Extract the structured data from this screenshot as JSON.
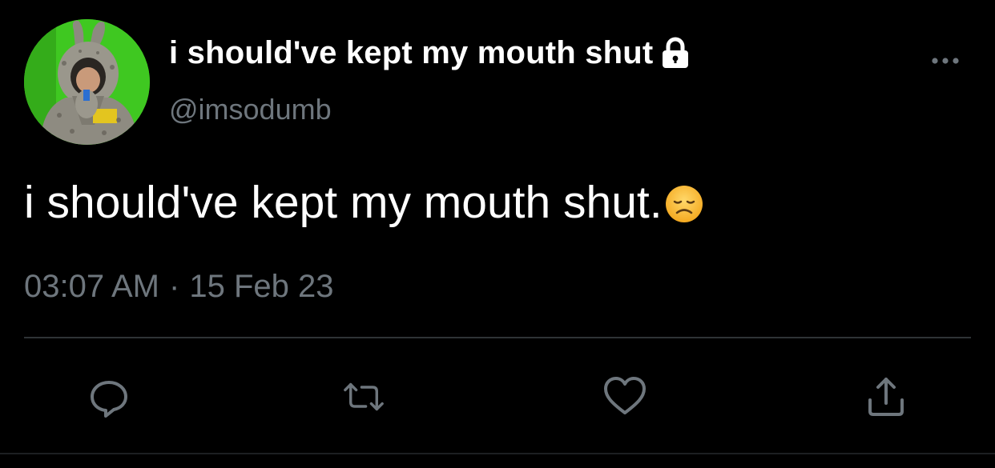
{
  "tweet": {
    "display_name": "i should've kept my mouth shut",
    "handle": "@imsodumb",
    "text": "i should've kept my mouth shut.",
    "time": "03:07 AM",
    "separator": "·",
    "date": "15 Feb 23"
  },
  "icons": {
    "lock": "lock-icon",
    "more": "more-horizontal-icon",
    "emoji": "disappointed-face-emoji",
    "reply": "reply-icon",
    "retweet": "retweet-icon",
    "like": "heart-icon",
    "share": "share-icon"
  },
  "colors": {
    "background": "#000000",
    "text_primary": "#ffffff",
    "text_secondary": "#6e767d",
    "divider": "#2f3336"
  }
}
